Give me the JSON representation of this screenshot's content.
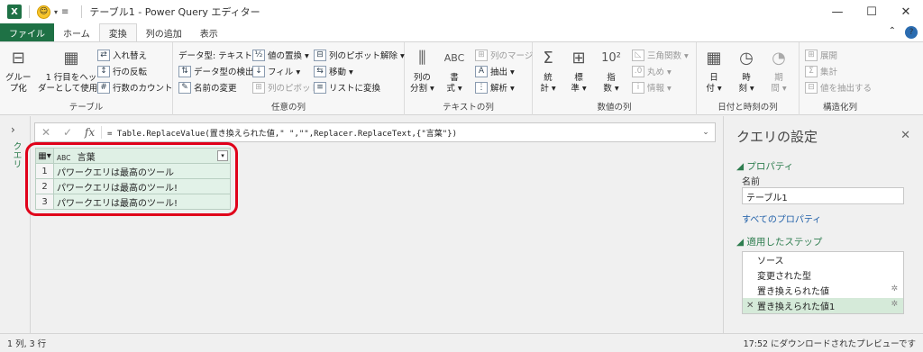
{
  "window": {
    "logo": "X",
    "title": "テーブル1 - Power Query エディター",
    "minimize_icon": "minimize-icon",
    "maximize_icon": "maximize-icon",
    "close_icon": "close-icon"
  },
  "tabs": {
    "file": "ファイル",
    "home": "ホーム",
    "transform": "変換",
    "add_column": "列の追加",
    "view": "表示"
  },
  "ribbon": {
    "table": {
      "label": "テーブル",
      "group_by": "グルー\nプ化",
      "use_first_row": "1 行目をヘッ\nダーとして使用 ▾",
      "transpose": "入れ替え",
      "reverse_rows": "行の反転",
      "count_rows": "行数のカウント"
    },
    "any_column": {
      "label": "任意の列",
      "data_type": "データ型: テキスト ▾",
      "detect_type": "データ型の検出",
      "rename": "名前の変更",
      "replace_values": "値の置換 ▾",
      "fill": "フィル ▾",
      "pivot": "列のピボット",
      "unpivot": "列のピボット解除 ▾",
      "move": "移動 ▾",
      "to_list": "リストに変換"
    },
    "text_column": {
      "label": "テキストの列",
      "split": "列の\n分割 ▾",
      "format": "書\n式 ▾",
      "merge": "列のマージ",
      "extract": "抽出 ▾",
      "parse": "解析 ▾"
    },
    "number_column": {
      "label": "数値の列",
      "statistics": "統\n計 ▾",
      "standard": "標\n準 ▾",
      "scientific": "指\n数 ▾",
      "trig": "三角関数 ▾",
      "rounding": "丸め ▾",
      "info": "情報 ▾"
    },
    "date_time": {
      "label": "日付と時刻の列",
      "date": "日\n付 ▾",
      "time": "時\n刻 ▾",
      "duration": "期\n間 ▾"
    },
    "structured": {
      "label": "構造化列",
      "expand": "展開",
      "aggregate": "集計",
      "extract_values": "値を抽出する"
    }
  },
  "left_pane": {
    "label": "クエリ"
  },
  "formula_bar": {
    "cancel": "✕",
    "confirm": "✓",
    "fx": "fx",
    "formula": "= Table.ReplaceValue(置き換えられた値,\"  \",\"\",Replacer.ReplaceText,{\"言葉\"})"
  },
  "grid": {
    "column_type": "ABC",
    "column_header": "言葉",
    "rows": [
      {
        "num": "1",
        "value": "パワークエリは最高のツール"
      },
      {
        "num": "2",
        "value": "パワークエリは最高のツール!"
      },
      {
        "num": "3",
        "value": "パワークエリは最高のツール!"
      }
    ]
  },
  "settings": {
    "title": "クエリの設定",
    "properties_header": "◢ プロパティ",
    "name_label": "名前",
    "name_value": "テーブル1",
    "all_properties": "すべてのプロパティ",
    "steps_header": "◢ 適用したステップ",
    "steps": [
      {
        "label": "ソース",
        "gear": false
      },
      {
        "label": "変更された型",
        "gear": false
      },
      {
        "label": "置き換えられた値",
        "gear": true
      },
      {
        "label": "置き換えられた値1",
        "gear": true
      }
    ]
  },
  "status": {
    "left": "1 列, 3 行",
    "right": "17:52 にダウンロードされたプレビューです"
  },
  "colors": {
    "excel_green": "#1e7145",
    "highlight_red": "#e0001a",
    "grid_green": "#e2f2e8"
  }
}
